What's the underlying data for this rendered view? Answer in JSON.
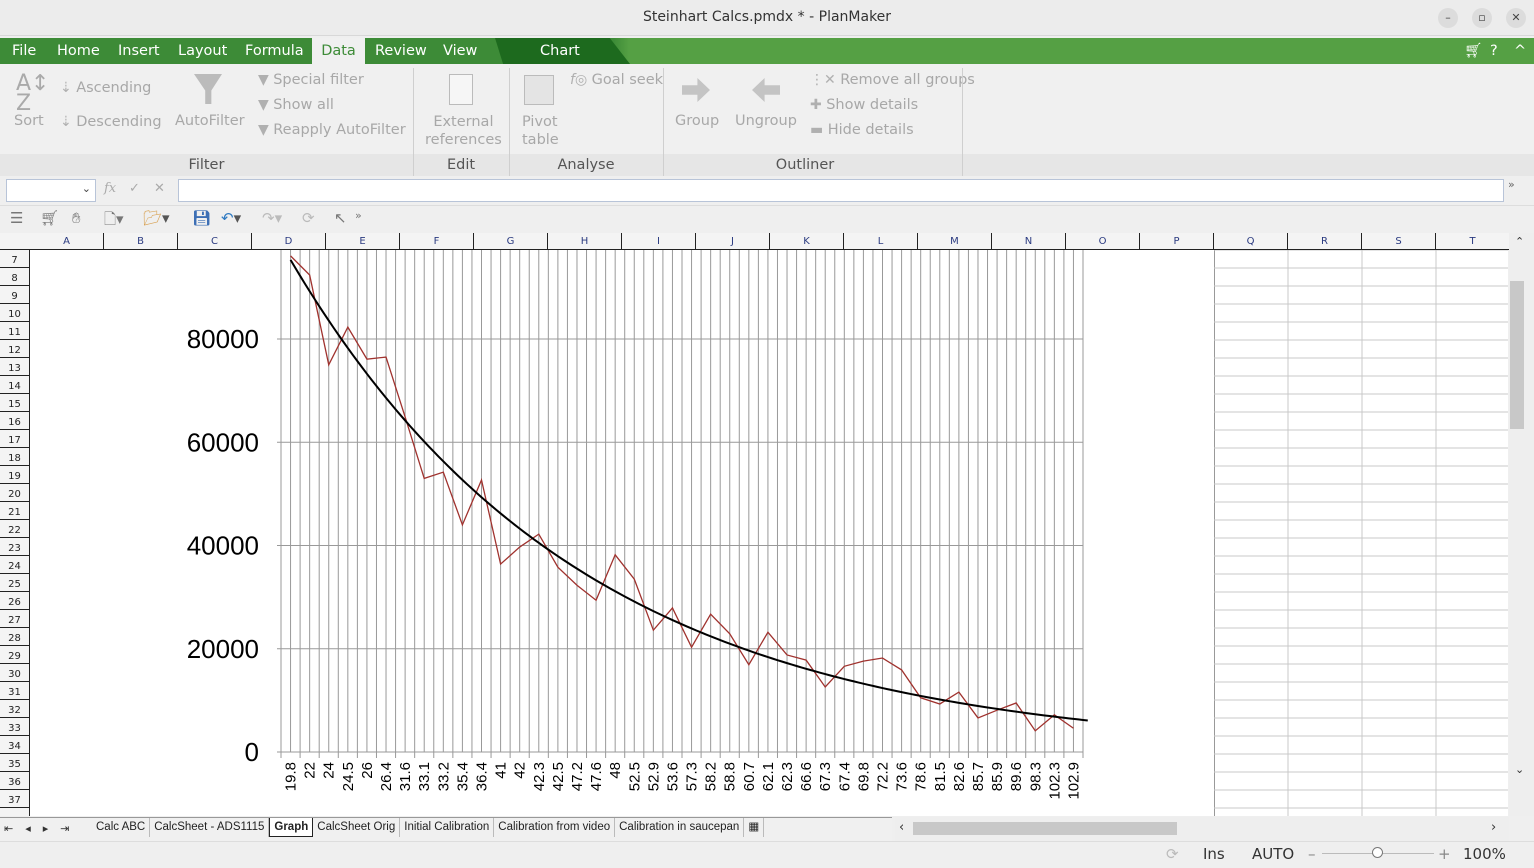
{
  "window": {
    "title": "Steinhart Calcs.pmdx * - PlanMaker"
  },
  "menu": {
    "items": [
      "File",
      "Home",
      "Insert",
      "Layout",
      "Formula",
      "Data",
      "Review",
      "View"
    ],
    "active": "Data",
    "context_tab": "Chart"
  },
  "ribbon": {
    "sort": "Sort",
    "ascending": "Ascending",
    "descending": "Descending",
    "autofilter": "AutoFilter",
    "special_filter": "Special filter",
    "show_all": "Show all",
    "reapply_autofilter": "Reapply AutoFilter",
    "external_references_1": "External",
    "external_references_2": "references",
    "pivot_table_1": "Pivot",
    "pivot_table_2": "table",
    "goal_seek": "Goal seek",
    "group": "Group",
    "ungroup": "Ungroup",
    "remove_all_groups": "Remove all groups",
    "show_details": "Show details",
    "hide_details": "Hide details",
    "groups": [
      "Filter",
      "Edit",
      "Analyse",
      "Outliner"
    ]
  },
  "formula_bar": {
    "name_box": "",
    "formula": "",
    "fx": "fx"
  },
  "columns": [
    "A",
    "B",
    "C",
    "D",
    "E",
    "F",
    "G",
    "H",
    "I",
    "J",
    "K",
    "L",
    "M",
    "N",
    "O",
    "P",
    "Q",
    "R",
    "S",
    "T"
  ],
  "rows": [
    "7",
    "8",
    "9",
    "10",
    "11",
    "12",
    "13",
    "14",
    "15",
    "16",
    "17",
    "18",
    "19",
    "20",
    "21",
    "22",
    "23",
    "24",
    "25",
    "26",
    "27",
    "28",
    "29",
    "30",
    "31",
    "32",
    "33",
    "34",
    "35",
    "36",
    "37"
  ],
  "sheet_tabs": [
    "Calc ABC",
    "CalcSheet - ADS1115",
    "Graph",
    "CalcSheet Orig",
    "Initial Calibration",
    "Calibration from video",
    "Calibration in saucepan"
  ],
  "active_sheet": "Graph",
  "status": {
    "mode": "Ins",
    "calc": "AUTO",
    "zoom": "100%",
    "zoom_level": 100
  },
  "colors": {
    "menu_green": "#3d8b37",
    "series": "#a0322e",
    "trend": "#000000",
    "grid": "#999999"
  },
  "chart_data": {
    "type": "line",
    "categories": [
      "19.8",
      "22",
      "24",
      "24.5",
      "26",
      "26.4",
      "31.6",
      "33.1",
      "33.2",
      "35.4",
      "36.4",
      "41",
      "42",
      "42.3",
      "42.5",
      "47.2",
      "47.6",
      "48",
      "52.5",
      "52.9",
      "53.6",
      "57.3",
      "58.2",
      "58.8",
      "60.7",
      "62.1",
      "62.3",
      "66.6",
      "67.3",
      "67.4",
      "69.8",
      "72.2",
      "73.6",
      "78.6",
      "81.5",
      "82.6",
      "85.7",
      "85.9",
      "89.6",
      "98.3",
      "102.3",
      "102.9"
    ],
    "series": [
      {
        "values": [
          96100,
          92400,
          75000,
          82300,
          76100,
          76500,
          64900,
          53000,
          54200,
          44000,
          52700,
          36400,
          39700,
          42200,
          35800,
          32300,
          29400,
          38200,
          33500,
          23600,
          27900,
          20300,
          26700,
          22900,
          16900,
          23200,
          18800,
          17800,
          12600,
          16600,
          17600,
          18200,
          15900,
          10500,
          9300,
          11600,
          6600,
          8100,
          9500,
          4100,
          7200,
          4600
        ]
      }
    ],
    "trendline": "exponential",
    "yticks": [
      "0",
      "20000",
      "40000",
      "60000",
      "80000"
    ],
    "ylim": [
      0,
      100000
    ],
    "grid": "both",
    "legend": "none"
  }
}
